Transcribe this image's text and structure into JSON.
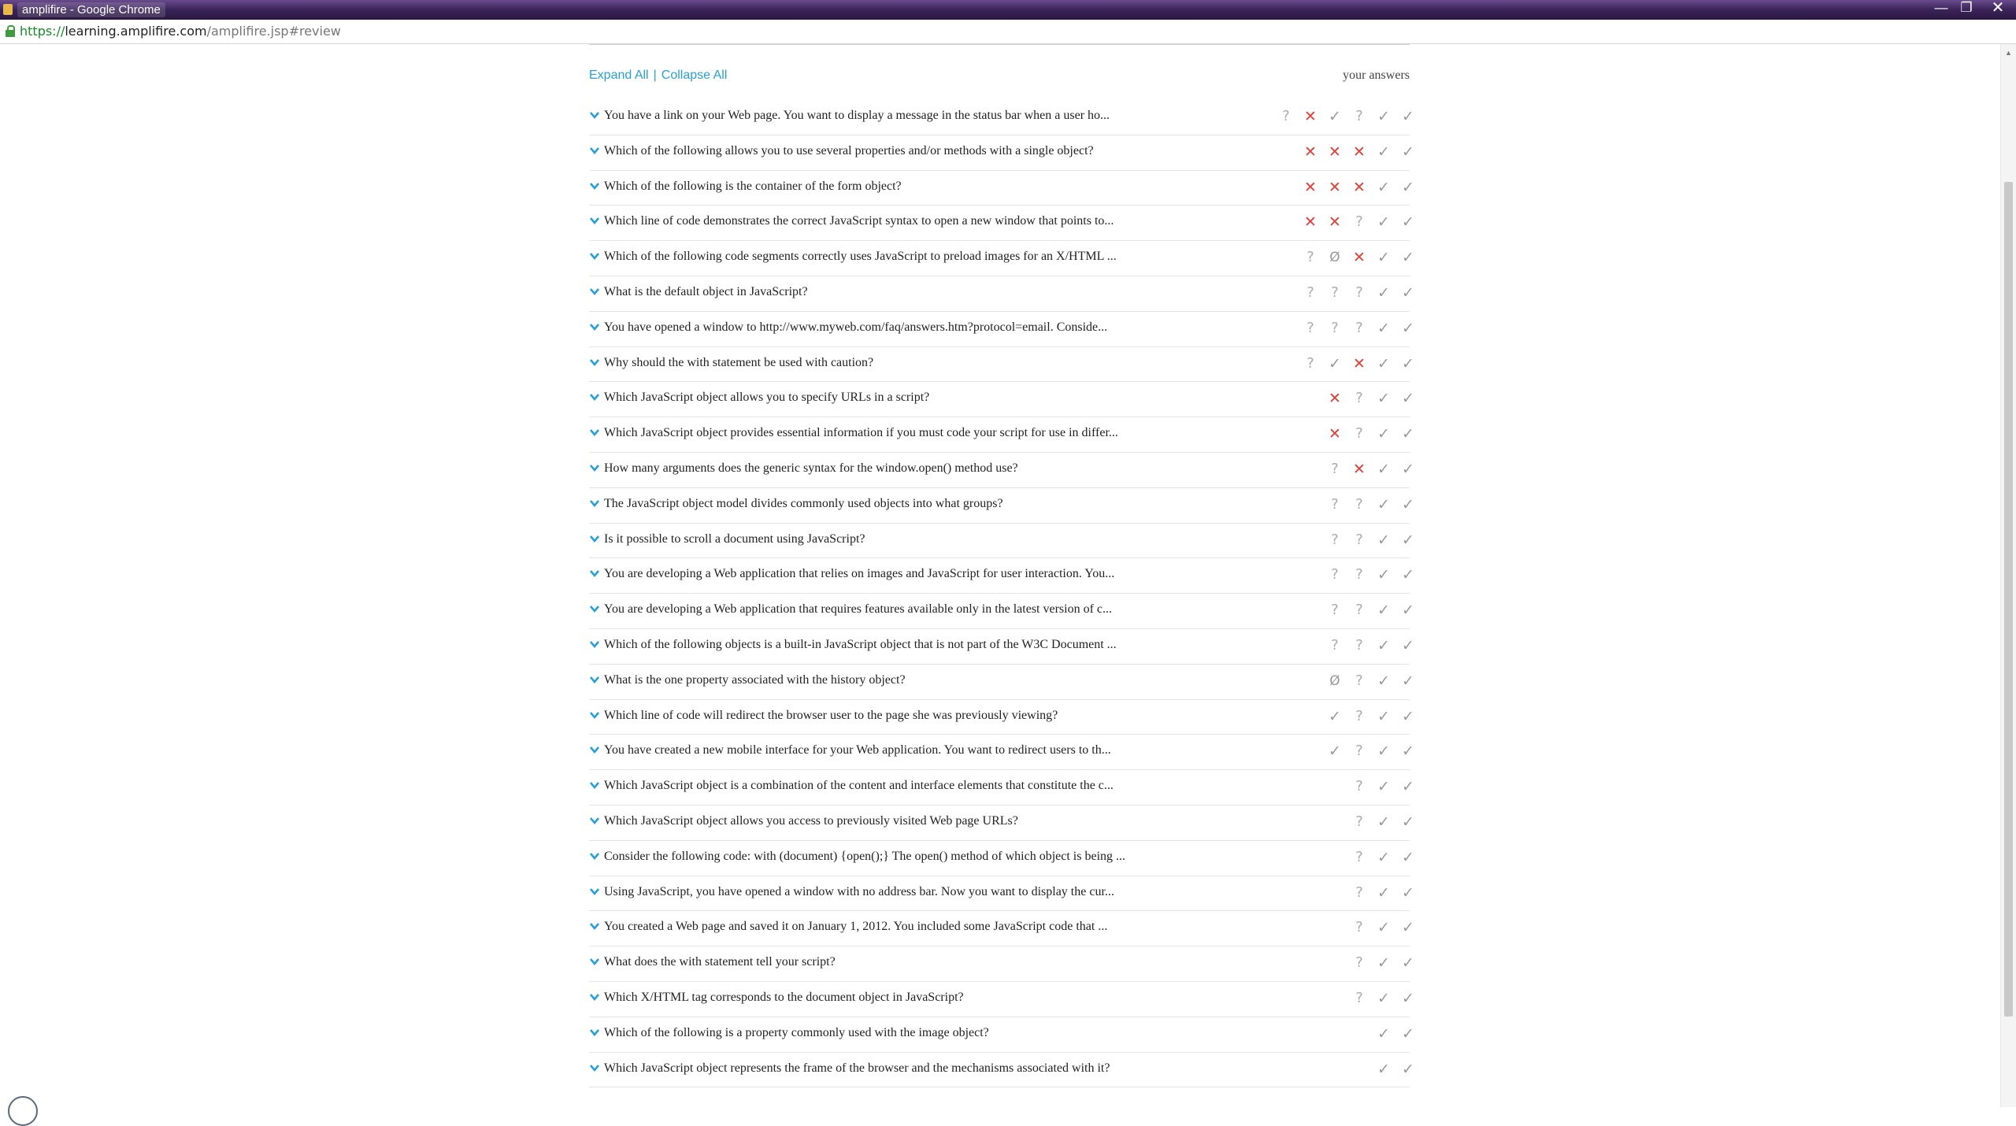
{
  "window": {
    "title": "amplifire - Google Chrome",
    "controls": {
      "minimize": "—",
      "restore": "❐",
      "close": "✕"
    }
  },
  "address_bar": {
    "scheme": "https://",
    "host": "learning.amplifire.com",
    "path": "/amplifire.jsp#review"
  },
  "header": {
    "expand_all": "Expand All",
    "separator": "|",
    "collapse_all": "Collapse All",
    "your_answers": "your answers"
  },
  "marks": {
    "check": "✓",
    "question": "?",
    "cross": "✕",
    "none": "Ø"
  },
  "colors": {
    "link": "#2a9fd6",
    "cross": "#e0403a",
    "check": "#9a9a9a"
  },
  "questions": [
    {
      "text": "You have a link on your Web page. You want to display a message in the status bar when a user ho...",
      "answers": [
        "question",
        "cross",
        "check",
        "question",
        "check",
        "check"
      ]
    },
    {
      "text": "Which of the following allows you to use several properties and/or methods with a single object?",
      "answers": [
        "cross",
        "cross",
        "cross",
        "check",
        "check"
      ]
    },
    {
      "text": "Which of the following is the container of the form object?",
      "answers": [
        "cross",
        "cross",
        "cross",
        "check",
        "check"
      ]
    },
    {
      "text": "Which line of code demonstrates the correct JavaScript syntax to open a new window that points to...",
      "answers": [
        "cross",
        "cross",
        "question",
        "check",
        "check"
      ]
    },
    {
      "text": "Which of the following code segments correctly uses JavaScript to preload images for an X/HTML ...",
      "answers": [
        "question",
        "none",
        "cross",
        "check",
        "check"
      ]
    },
    {
      "text": "What is the default object in JavaScript?",
      "answers": [
        "question",
        "question",
        "question",
        "check",
        "check"
      ]
    },
    {
      "text": "You have opened a window to http://www.myweb.com/faq/answers.htm?protocol=email. Conside...",
      "answers": [
        "question",
        "question",
        "question",
        "check",
        "check"
      ]
    },
    {
      "text": "Why should the with statement be used with caution?",
      "answers": [
        "question",
        "check",
        "cross",
        "check",
        "check"
      ]
    },
    {
      "text": "Which JavaScript object allows you to specify URLs in a script?",
      "answers": [
        "cross",
        "question",
        "check",
        "check"
      ]
    },
    {
      "text": "Which JavaScript object provides essential information if you must code your script for use in differ...",
      "answers": [
        "cross",
        "question",
        "check",
        "check"
      ]
    },
    {
      "text": "How many arguments does the generic syntax for the window.open() method use?",
      "answers": [
        "question",
        "cross",
        "check",
        "check"
      ]
    },
    {
      "text": "The JavaScript object model divides commonly used objects into what groups?",
      "answers": [
        "question",
        "question",
        "check",
        "check"
      ]
    },
    {
      "text": "Is it possible to scroll a document using JavaScript?",
      "answers": [
        "question",
        "question",
        "check",
        "check"
      ]
    },
    {
      "text": "You are developing a Web application that relies on images and JavaScript for user interaction. You...",
      "answers": [
        "question",
        "question",
        "check",
        "check"
      ]
    },
    {
      "text": "You are developing a Web application that requires features available only in the latest version of c...",
      "answers": [
        "question",
        "question",
        "check",
        "check"
      ]
    },
    {
      "text": "Which of the following objects is a built-in JavaScript object that is not part of the W3C Document ...",
      "answers": [
        "question",
        "question",
        "check",
        "check"
      ]
    },
    {
      "text": "What is the one property associated with the history object?",
      "answers": [
        "none",
        "question",
        "check",
        "check"
      ]
    },
    {
      "text": "Which line of code will redirect the browser user to the page she was previously viewing?",
      "answers": [
        "check",
        "question",
        "check",
        "check"
      ]
    },
    {
      "text": "You have created a new mobile interface for your Web application. You want to redirect users to th...",
      "answers": [
        "check",
        "question",
        "check",
        "check"
      ]
    },
    {
      "text": "Which JavaScript object is a combination of the content and interface elements that constitute the c...",
      "answers": [
        "question",
        "check",
        "check"
      ]
    },
    {
      "text": "Which JavaScript object allows you access to previously visited Web page URLs?",
      "answers": [
        "question",
        "check",
        "check"
      ]
    },
    {
      "text": "Consider the following code: with (document) {open();} The open() method of which object is being ...",
      "answers": [
        "question",
        "check",
        "check"
      ]
    },
    {
      "text": "Using JavaScript, you have opened a window with no address bar. Now you want to display the cur...",
      "answers": [
        "question",
        "check",
        "check"
      ]
    },
    {
      "text": "You created a Web page and saved it on January 1, 2012. You included some JavaScript code that ...",
      "answers": [
        "question",
        "check",
        "check"
      ]
    },
    {
      "text": "What does the with statement tell your script?",
      "answers": [
        "question",
        "check",
        "check"
      ]
    },
    {
      "text": "Which X/HTML tag corresponds to the document object in JavaScript?",
      "answers": [
        "question",
        "check",
        "check"
      ]
    },
    {
      "text": "Which of the following is a property commonly used with the image object?",
      "answers": [
        "check",
        "check"
      ]
    },
    {
      "text": "Which JavaScript object represents the frame of the browser and the mechanisms associated with it?",
      "answers": [
        "check",
        "check"
      ]
    }
  ]
}
